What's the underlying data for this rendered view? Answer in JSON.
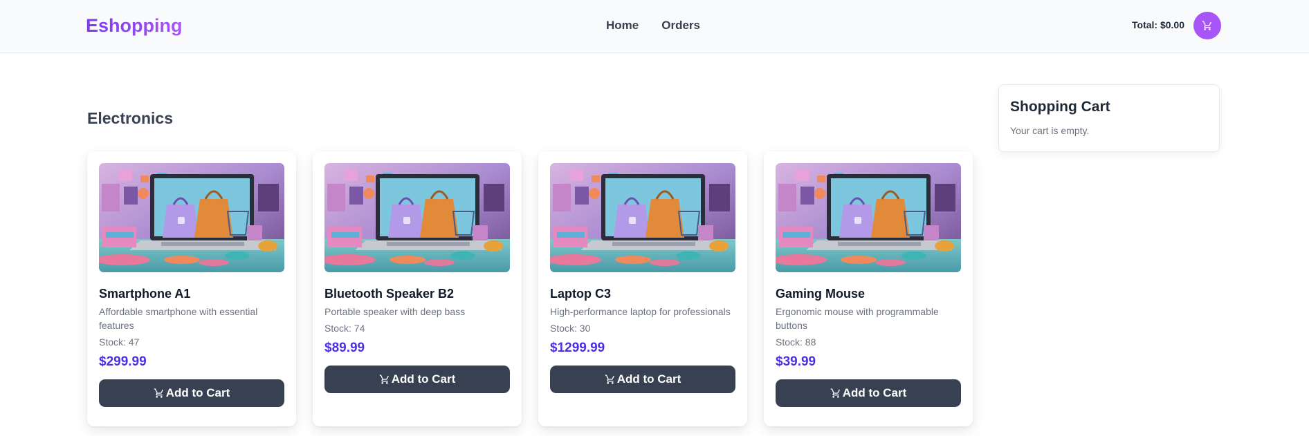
{
  "nav": {
    "brand": "Eshopping",
    "links": [
      "Home",
      "Orders"
    ],
    "total": "Total: $0.00",
    "cart_icon": "cart-icon"
  },
  "section": {
    "title": "Electronics"
  },
  "products": [
    {
      "name": "Smartphone A1",
      "description": "Affordable smartphone with essential features",
      "stock": "Stock: 47",
      "price": "$299.99",
      "button": "Add to Cart"
    },
    {
      "name": "Bluetooth Speaker B2",
      "description": "Portable speaker with deep bass",
      "stock": "Stock: 74",
      "price": "$89.99",
      "button": "Add to Cart"
    },
    {
      "name": "Laptop C3",
      "description": "High-performance laptop for professionals",
      "stock": "Stock: 30",
      "price": "$1299.99",
      "button": "Add to Cart"
    },
    {
      "name": "Gaming Mouse",
      "description": "Ergonomic mouse with programmable buttons",
      "stock": "Stock: 88",
      "price": "$39.99",
      "button": "Add to Cart"
    }
  ],
  "cart": {
    "title": "Shopping Cart",
    "empty_message": "Your cart is empty."
  },
  "colors": {
    "accent": "#a855f7",
    "price": "#4f2fe0",
    "button": "#374151"
  }
}
